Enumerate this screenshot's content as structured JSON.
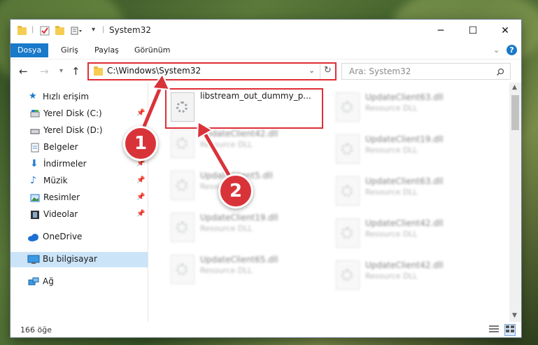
{
  "window": {
    "title": "System32",
    "controls": {
      "minimize": "─",
      "maximize": "☐",
      "close": "✕"
    }
  },
  "ribbon": {
    "tabs": [
      "Dosya",
      "Giriş",
      "Paylaş",
      "Görünüm"
    ],
    "active_tab": "Dosya"
  },
  "address": {
    "path": "C:\\Windows\\System32",
    "search_placeholder": "Ara: System32"
  },
  "nav": {
    "quick_access": "Hızlı erişim",
    "items": [
      {
        "label": "Yerel Disk (C:)",
        "icon": "drive-icon",
        "pinned": true
      },
      {
        "label": "Yerel Disk (D:)",
        "icon": "drive-icon",
        "pinned": false
      },
      {
        "label": "Belgeler",
        "icon": "documents-icon",
        "pinned": false
      },
      {
        "label": "İndirmeler",
        "icon": "download-icon",
        "pinned": true
      },
      {
        "label": "Müzik",
        "icon": "music-icon",
        "pinned": true
      },
      {
        "label": "Resimler",
        "icon": "pictures-icon",
        "pinned": true
      },
      {
        "label": "Videolar",
        "icon": "videos-icon",
        "pinned": true
      }
    ],
    "onedrive": "OneDrive",
    "this_pc": "Bu bilgisayar",
    "network": "Ağ"
  },
  "files": {
    "highlighted": {
      "name": "libstream_out_dummy_p...",
      "type": ""
    },
    "left_column": [
      {
        "name": "UpdateClient42.dll",
        "type": "Resource DLL"
      },
      {
        "name": "UpdateClient5.dll",
        "type": "Resource DLL"
      },
      {
        "name": "UpdateClient19.dll",
        "type": "Resource DLL"
      },
      {
        "name": "UpdateClient65.dll",
        "type": "Resource DLL"
      }
    ],
    "right_column": [
      {
        "name": "UpdateClient63.dll",
        "type": "Resource DLL"
      },
      {
        "name": "UpdateClient19.dll",
        "type": "Resource DLL"
      },
      {
        "name": "UpdateClient63.dll",
        "type": "Resource DLL"
      },
      {
        "name": "UpdateClient42.dll",
        "type": "Resource DLL"
      },
      {
        "name": "UpdateClient42.dll",
        "type": "Resource DLL"
      }
    ]
  },
  "status": {
    "count": "166 öğe"
  },
  "annotations": {
    "marker_1": "1",
    "marker_2": "2"
  },
  "colors": {
    "accent": "#1979ca",
    "highlight": "#e02e35",
    "selected": "#cce4f7"
  }
}
